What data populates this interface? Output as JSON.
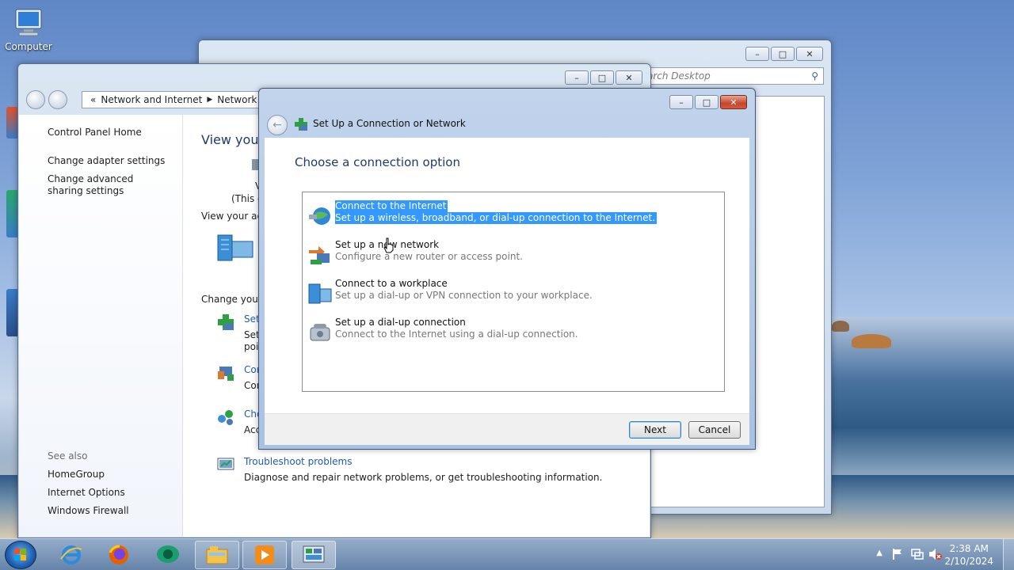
{
  "desktop": {
    "icons": [
      {
        "name": "computer",
        "label": "Computer"
      }
    ]
  },
  "back_window": {
    "search_placeholder": "arch Desktop"
  },
  "network_window": {
    "breadcrumb": [
      "Network and Internet",
      "Network a"
    ],
    "sidebar": {
      "home": "Control Panel Home",
      "links": [
        "Change adapter settings",
        "Change advanced sharing settings"
      ],
      "see_also_label": "See also",
      "see_also": [
        "HomeGroup",
        "Internet Options",
        "Windows Firewall"
      ]
    },
    "main": {
      "view_heading": "View your",
      "this_c": "(This c",
      "v_char": "V",
      "view_active": "View your acti",
      "change_heading": "Change your",
      "items": [
        {
          "title": "Set",
          "desc": "Set",
          "desc2": "poi"
        },
        {
          "title": "Con",
          "desc": "Cor"
        },
        {
          "title": "Cho",
          "desc": "Acc"
        }
      ],
      "troubleshoot": {
        "title": "Troubleshoot problems",
        "desc": "Diagnose and repair network problems, or get troubleshooting information."
      }
    }
  },
  "dialog": {
    "title": "Set Up a Connection or Network",
    "heading": "Choose a connection option",
    "options": [
      {
        "title": "Connect to the Internet",
        "desc": "Set up a wireless, broadband, or dial-up connection to the Internet.",
        "selected": true,
        "icon": "globe-icon"
      },
      {
        "title": "Set up a new network",
        "desc": "Configure a new router or access point.",
        "selected": false,
        "icon": "router-icon"
      },
      {
        "title": "Connect to a workplace",
        "desc": "Set up a dial-up or VPN connection to your workplace.",
        "selected": false,
        "icon": "workplace-icon"
      },
      {
        "title": "Set up a dial-up connection",
        "desc": "Connect to the Internet using a dial-up connection.",
        "selected": false,
        "icon": "phone-icon"
      }
    ],
    "next_label": "Next",
    "cancel_label": "Cancel"
  },
  "taskbar": {
    "pinned": [
      "internet-explorer-icon",
      "firefox-icon",
      "chat-icon",
      "explorer-icon",
      "media-player-icon",
      "control-panel-icon"
    ],
    "time": "2:38 AM",
    "date": "2/10/2024"
  }
}
